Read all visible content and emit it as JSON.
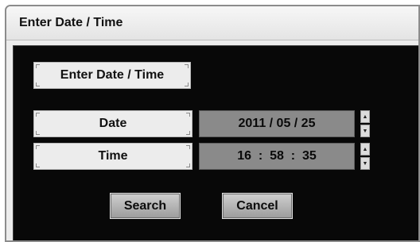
{
  "window": {
    "title": "Enter Date / Time"
  },
  "panel": {
    "heading": "Enter Date / Time",
    "date": {
      "label": "Date",
      "value": "2011 / 05 / 25"
    },
    "time": {
      "label": "Time",
      "value": "16  :  58  :  35"
    },
    "spinner": {
      "up_glyph": "▲",
      "down_glyph": "▼"
    }
  },
  "buttons": {
    "search": "Search",
    "cancel": "Cancel"
  }
}
